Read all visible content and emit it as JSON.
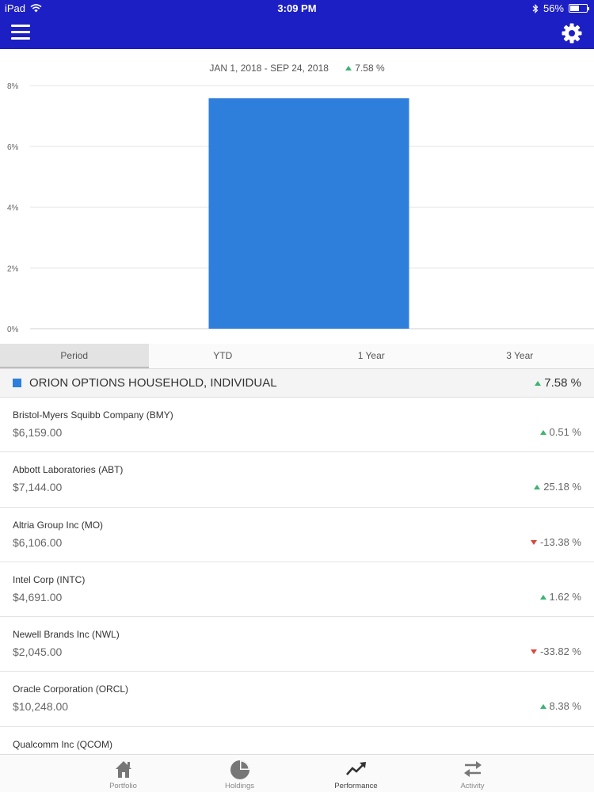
{
  "status_bar": {
    "carrier": "iPad",
    "time": "3:09 PM",
    "battery": "56%",
    "battery_level": 0.56
  },
  "nav": {
    "menu_icon": "hamburger-icon",
    "settings_icon": "gear-icon"
  },
  "chart_header": {
    "date_range": "JAN 1, 2018 - SEP 24, 2018",
    "return": "7.58 %"
  },
  "chart_data": {
    "type": "bar",
    "categories": [
      ""
    ],
    "values": [
      7.58
    ],
    "ylim": [
      0,
      8
    ],
    "yticks": [
      "0%",
      "2%",
      "4%",
      "6%",
      "8%"
    ],
    "grid": true,
    "color": "#2e7fdb"
  },
  "tabs": [
    {
      "label": "Period",
      "active": true
    },
    {
      "label": "YTD",
      "active": false
    },
    {
      "label": "1 Year",
      "active": false
    },
    {
      "label": "3 Year",
      "active": false
    }
  ],
  "account": {
    "name": "ORION OPTIONS HOUSEHOLD, INDIVIDUAL",
    "return": "7.58 %",
    "color": "#2e7fdb"
  },
  "holdings": [
    {
      "name": "Bristol-Myers Squibb Company (BMY)",
      "value": "$6,159.00",
      "change": "0.51 %",
      "direction": "up"
    },
    {
      "name": "Abbott Laboratories (ABT)",
      "value": "$7,144.00",
      "change": "25.18 %",
      "direction": "up"
    },
    {
      "name": "Altria Group Inc (MO)",
      "value": "$6,106.00",
      "change": "-13.38 %",
      "direction": "down"
    },
    {
      "name": "Intel Corp (INTC)",
      "value": "$4,691.00",
      "change": "1.62 %",
      "direction": "up"
    },
    {
      "name": "Newell Brands Inc (NWL)",
      "value": "$2,045.00",
      "change": "-33.82 %",
      "direction": "down"
    },
    {
      "name": "Oracle Corporation (ORCL)",
      "value": "$10,248.00",
      "change": "8.38 %",
      "direction": "up"
    },
    {
      "name": "Qualcomm Inc (QCOM)",
      "value": "",
      "change": "",
      "direction": ""
    }
  ],
  "bottom_tabs": [
    {
      "label": "Portfolio",
      "icon": "home-icon",
      "active": false
    },
    {
      "label": "Holdings",
      "icon": "pie-chart-icon",
      "active": false
    },
    {
      "label": "Performance",
      "icon": "trend-up-icon",
      "active": true
    },
    {
      "label": "Activity",
      "icon": "swap-arrows-icon",
      "active": false
    }
  ],
  "colors": {
    "nav_bg": "#1c1fc4",
    "up": "#3cb371",
    "down": "#d9473b"
  }
}
